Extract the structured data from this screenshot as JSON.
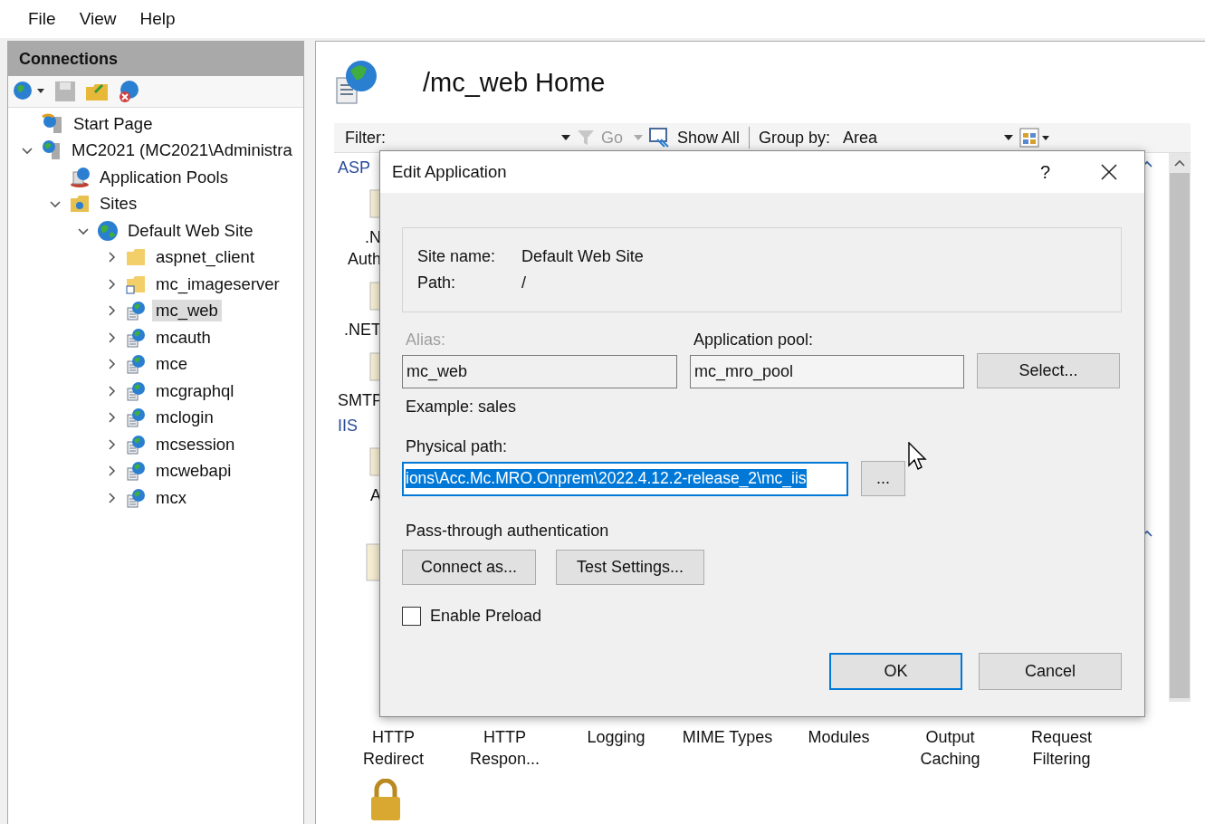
{
  "menu": [
    "File",
    "View",
    "Help"
  ],
  "connections": {
    "title": "Connections",
    "tree": [
      {
        "label": "Start Page",
        "kind": "start",
        "selected": false
      },
      {
        "label": "MC2021 (MC2021\\Administra",
        "kind": "server",
        "expanded": true,
        "selected": false,
        "children": [
          {
            "label": "Application Pools",
            "kind": "pools",
            "selected": false
          },
          {
            "label": "Sites",
            "kind": "sites",
            "expanded": true,
            "selected": false,
            "children": [
              {
                "label": "Default Web Site",
                "kind": "site",
                "expanded": true,
                "selected": false,
                "children": [
                  {
                    "label": "aspnet_client",
                    "kind": "folder",
                    "expanded": false,
                    "selected": false
                  },
                  {
                    "label": "mc_imageserver",
                    "kind": "vdir",
                    "expanded": false,
                    "selected": false
                  },
                  {
                    "label": "mc_web",
                    "kind": "app",
                    "expanded": false,
                    "selected": true
                  },
                  {
                    "label": "mcauth",
                    "kind": "app",
                    "expanded": false,
                    "selected": false
                  },
                  {
                    "label": "mce",
                    "kind": "app",
                    "expanded": false,
                    "selected": false
                  },
                  {
                    "label": "mcgraphql",
                    "kind": "app",
                    "expanded": false,
                    "selected": false
                  },
                  {
                    "label": "mclogin",
                    "kind": "app",
                    "expanded": false,
                    "selected": false
                  },
                  {
                    "label": "mcsession",
                    "kind": "app",
                    "expanded": false,
                    "selected": false
                  },
                  {
                    "label": "mcwebapi",
                    "kind": "app",
                    "expanded": false,
                    "selected": false
                  },
                  {
                    "label": "mcx",
                    "kind": "app",
                    "expanded": false,
                    "selected": false
                  }
                ]
              }
            ]
          }
        ]
      }
    ]
  },
  "home": {
    "title": "/mc_web Home",
    "filter": {
      "label": "Filter:",
      "go": "Go",
      "show_all": "Show All",
      "group_by_label": "Group by:",
      "group_by_value": "Area"
    },
    "column": [
      {
        "kind": "group",
        "lines": [
          "ASP"
        ]
      },
      {
        "kind": "item",
        "lines": [
          ".N",
          "Auth"
        ]
      },
      {
        "kind": "item",
        "lines": [
          ".NET"
        ]
      },
      {
        "kind": "item",
        "lines": [
          "SMTP"
        ]
      },
      {
        "kind": "group",
        "lines": [
          "IIS"
        ]
      },
      {
        "kind": "item",
        "lines": [
          "A"
        ]
      }
    ],
    "features": [
      {
        "lines": [
          "HTTP",
          "Redirect"
        ]
      },
      {
        "lines": [
          "HTTP",
          "Respon..."
        ]
      },
      {
        "lines": [
          "Logging"
        ]
      },
      {
        "lines": [
          "MIME Types"
        ]
      },
      {
        "lines": [
          "Modules"
        ]
      },
      {
        "lines": [
          "Output",
          "Caching"
        ]
      },
      {
        "lines": [
          "Request",
          "Filtering"
        ]
      }
    ]
  },
  "dialog": {
    "title": "Edit Application",
    "help": "?",
    "site_name_label": "Site name:",
    "site_name": "Default Web Site",
    "path_label": "Path:",
    "path": "/",
    "alias": {
      "label": "Alias:",
      "value": "mc_web",
      "disabled": true
    },
    "app_pool": {
      "label": "Application pool:",
      "value": "mc_mro_pool"
    },
    "select": "Select...",
    "example": "Example: sales",
    "physical_path": {
      "label": "Physical path:",
      "value": "ions\\Acc.Mc.MRO.Onprem\\2022.4.12.2-release_2\\mc_iis",
      "selected": true
    },
    "browse": "...",
    "pass_through": "Pass-through authentication",
    "connect_as": "Connect as...",
    "test_settings": "Test Settings...",
    "preload": {
      "label": "Enable Preload",
      "checked": false
    },
    "ok": "OK",
    "cancel": "Cancel"
  }
}
